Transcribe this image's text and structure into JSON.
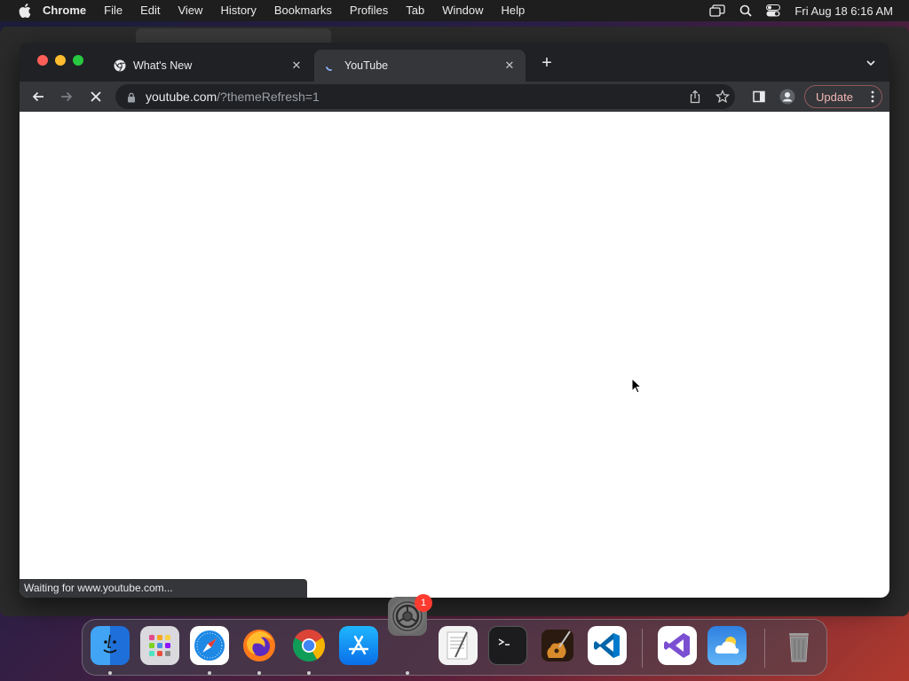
{
  "menubar": {
    "app_name": "Chrome",
    "items": [
      "File",
      "Edit",
      "View",
      "History",
      "Bookmarks",
      "Profiles",
      "Tab",
      "Window",
      "Help"
    ],
    "clock": "Fri Aug 18  6:16 AM"
  },
  "browser": {
    "tabs": [
      {
        "title": "What's New",
        "icon": "chrome-icon"
      },
      {
        "title": "YouTube",
        "icon": "loading-spinner-icon",
        "active": true
      }
    ],
    "url_host": "youtube.com",
    "url_path": "/?themeRefresh=1",
    "update_label": "Update",
    "status_text": "Waiting for www.youtube.com..."
  },
  "dock": {
    "apps": [
      "finder",
      "launchpad",
      "safari",
      "firefox",
      "chrome",
      "app-store",
      "textedit",
      "terminal",
      "garageband",
      "vscode",
      "visual-studio",
      "weather",
      "trash"
    ],
    "floating_app": "system-settings",
    "badge_count": "1"
  },
  "colors": {
    "window_bg": "#202124",
    "toolbar_bg": "#35363a",
    "update_text": "#f2b8b5",
    "badge": "#ff3b30"
  }
}
